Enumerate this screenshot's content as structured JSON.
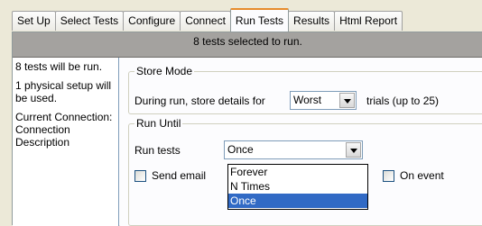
{
  "tabs": [
    "Set Up",
    "Select Tests",
    "Configure",
    "Connect",
    "Run Tests",
    "Results",
    "Html Report"
  ],
  "active_tab": "Run Tests",
  "banner": "8 tests selected to run.",
  "sidebar": {
    "lines": [
      "8 tests will be run.",
      "1 physical setup will be used.",
      "Current Connection: Connection Description"
    ]
  },
  "store_mode": {
    "legend": "Store Mode",
    "prefix": "During run, store details for",
    "value": "Worst",
    "suffix": "trials (up to 25)"
  },
  "run_until": {
    "legend": "Run Until",
    "run_tests_label": "Run tests",
    "run_tests_value": "Once",
    "options": [
      "Forever",
      "N Times",
      "Once"
    ],
    "selected_option": "Once",
    "send_email_label": "Send email",
    "on_event_label": "On event"
  },
  "colors": {
    "accent": "#316ac5",
    "active_tab_top": "#e68b2c",
    "banner": "#a4a29f"
  }
}
